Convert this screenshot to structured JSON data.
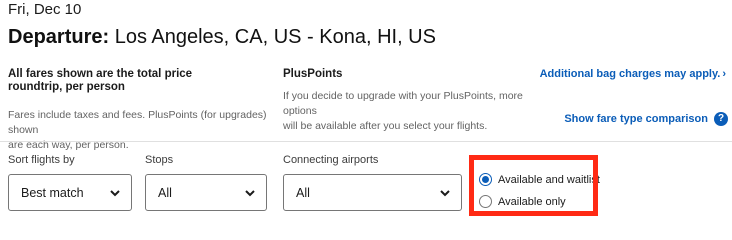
{
  "header": {
    "date": "Fri, Dec 10",
    "title_label": "Departure:",
    "route": "Los Angeles, CA, US - Kona, HI, US"
  },
  "fares_info": {
    "heading_line1": "All fares shown are the total price",
    "heading_line2": "roundtrip, per person",
    "text_line1": "Fares include taxes and fees. PlusPoints (for upgrades) shown",
    "text_line2": "are each way, per person."
  },
  "pluspoints": {
    "heading": "PlusPoints",
    "text_line1": "If you decide to upgrade with your PlusPoints, more options",
    "text_line2": "will be available after you select your flights."
  },
  "links": {
    "bag_charges": "Additional bag charges may apply.",
    "bag_chevron": "›",
    "fare_comparison": "Show fare type comparison",
    "help_glyph": "?"
  },
  "filters": {
    "sort": {
      "label": "Sort flights by",
      "value": "Best match"
    },
    "stops": {
      "label": "Stops",
      "value": "All"
    },
    "connecting": {
      "label": "Connecting airports",
      "value": "All"
    },
    "upgrade": {
      "options": [
        {
          "label": "Available and waitlist",
          "selected": true
        },
        {
          "label": "Available only",
          "selected": false
        }
      ]
    }
  },
  "colors": {
    "link": "#0b5db8",
    "highlight": "#ff2a14"
  }
}
